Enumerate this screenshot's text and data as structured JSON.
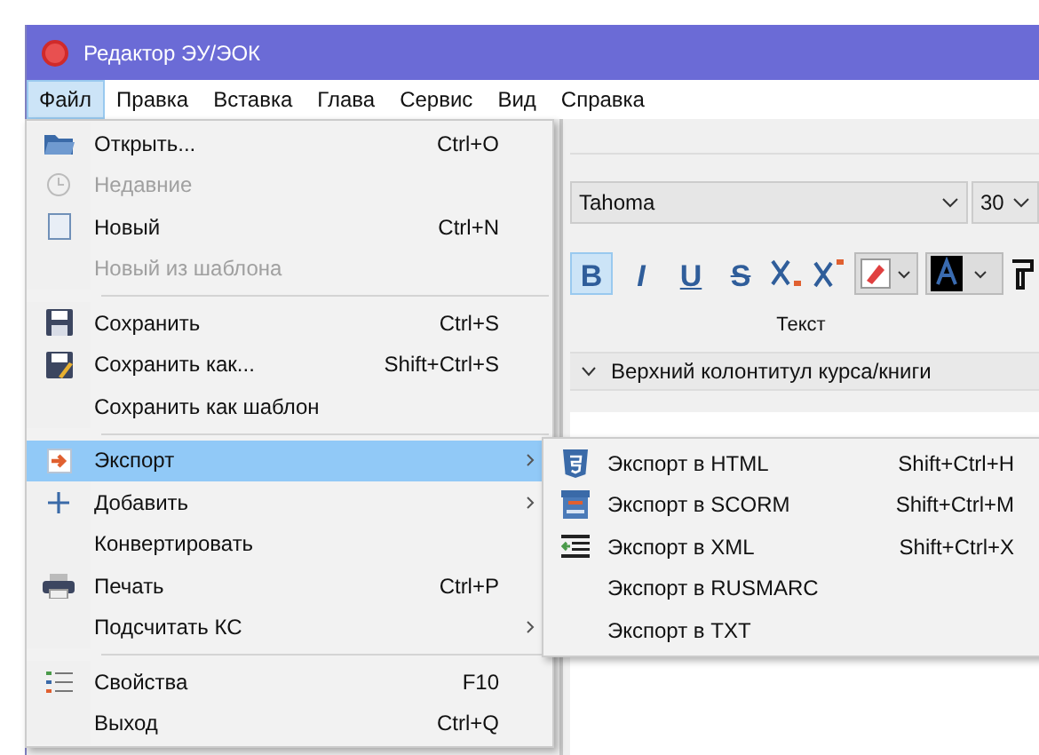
{
  "window": {
    "title": "Редактор ЭУ/ЭОК"
  },
  "menubar": [
    {
      "label": "Файл",
      "selected": true
    },
    {
      "label": "Правка",
      "selected": false
    },
    {
      "label": "Вставка",
      "selected": false
    },
    {
      "label": "Глава",
      "selected": false
    },
    {
      "label": "Сервис",
      "selected": false
    },
    {
      "label": "Вид",
      "selected": false
    },
    {
      "label": "Справка",
      "selected": false
    }
  ],
  "ribbon": {
    "font": "Tahoma",
    "size": "30",
    "format_buttons": [
      {
        "label": "B",
        "selected": true
      },
      {
        "label": "I",
        "selected": false
      },
      {
        "label": "U",
        "selected": false
      },
      {
        "label": "S",
        "selected": false
      }
    ],
    "group_label": "Текст"
  },
  "outline": {
    "label": "Верхний колонтитул курса/книги",
    "expanded": true
  },
  "file_menu": [
    {
      "kind": "item",
      "label": "Открыть...",
      "shortcut": "Ctrl+O",
      "disabled": false,
      "selected": false,
      "submenu": false
    },
    {
      "kind": "item",
      "label": "Недавние",
      "disabled": true,
      "selected": false,
      "submenu": false
    },
    {
      "kind": "item",
      "label": "Новый",
      "shortcut": "Ctrl+N",
      "disabled": false,
      "selected": false,
      "submenu": false
    },
    {
      "kind": "item",
      "label": "Новый из шаблона",
      "disabled": true,
      "selected": false,
      "submenu": false
    },
    {
      "kind": "separator"
    },
    {
      "kind": "item",
      "label": "Сохранить",
      "shortcut": "Ctrl+S",
      "disabled": false,
      "selected": false,
      "submenu": false
    },
    {
      "kind": "item",
      "label": "Сохранить как...",
      "shortcut": "Shift+Ctrl+S",
      "disabled": false,
      "selected": false,
      "submenu": false
    },
    {
      "kind": "item",
      "label": "Сохранить как шаблон",
      "disabled": false,
      "selected": false,
      "submenu": false
    },
    {
      "kind": "separator"
    },
    {
      "kind": "item",
      "label": "Экспорт",
      "disabled": false,
      "selected": true,
      "submenu": true
    },
    {
      "kind": "item",
      "label": "Добавить",
      "disabled": false,
      "selected": false,
      "submenu": true
    },
    {
      "kind": "item",
      "label": "Конвертировать",
      "disabled": false,
      "selected": false,
      "submenu": false
    },
    {
      "kind": "item",
      "label": "Печать",
      "shortcut": "Ctrl+P",
      "disabled": false,
      "selected": false,
      "submenu": false
    },
    {
      "kind": "item",
      "label": "Подсчитать КС",
      "disabled": false,
      "selected": false,
      "submenu": true
    },
    {
      "kind": "separator"
    },
    {
      "kind": "item",
      "label": "Свойства",
      "shortcut": "F10",
      "disabled": false,
      "selected": false,
      "submenu": false
    },
    {
      "kind": "item",
      "label": "Выход",
      "shortcut": "Ctrl+Q",
      "disabled": false,
      "selected": false,
      "submenu": false
    }
  ],
  "export_submenu": [
    {
      "label": "Экспорт в HTML",
      "shortcut": "Shift+Ctrl+H"
    },
    {
      "label": "Экспорт в SCORM",
      "shortcut": "Shift+Ctrl+M"
    },
    {
      "label": "Экспорт в XML",
      "shortcut": "Shift+Ctrl+X"
    },
    {
      "label": "Экспорт в RUSMARC"
    },
    {
      "label": "Экспорт в TXT"
    }
  ]
}
